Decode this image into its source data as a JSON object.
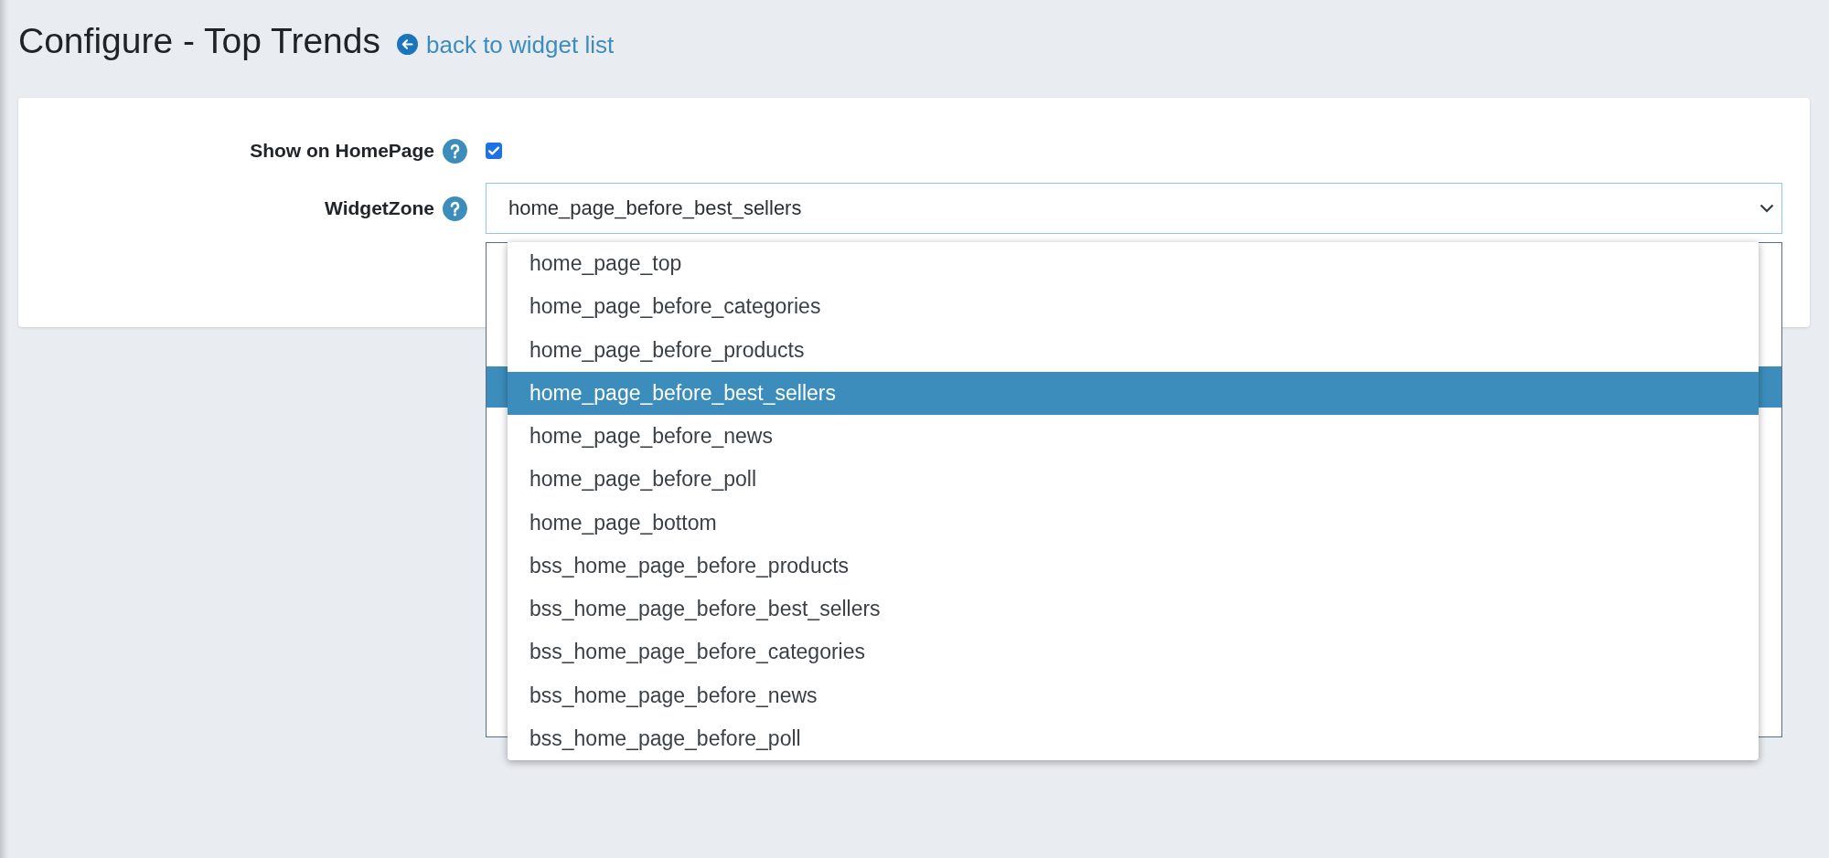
{
  "header": {
    "title": "Configure - Top Trends",
    "back_link": "back to widget list"
  },
  "form": {
    "fields": [
      {
        "kind": "checkbox",
        "label": "Show on HomePage",
        "checked": true
      },
      {
        "kind": "select",
        "label": "WidgetZone",
        "value": "home_page_before_best_sellers",
        "expanded": true,
        "options": [
          {
            "label": "home_page_top",
            "selected": false
          },
          {
            "label": "home_page_before_categories",
            "selected": false
          },
          {
            "label": "home_page_before_products",
            "selected": false
          },
          {
            "label": "home_page_before_best_sellers",
            "selected": true
          },
          {
            "label": "home_page_before_news",
            "selected": false
          },
          {
            "label": "home_page_before_poll",
            "selected": false
          },
          {
            "label": "home_page_bottom",
            "selected": false
          },
          {
            "label": "bss_home_page_before_products",
            "selected": false
          },
          {
            "label": "bss_home_page_before_best_sellers",
            "selected": false
          },
          {
            "label": "bss_home_page_before_categories",
            "selected": false
          },
          {
            "label": "bss_home_page_before_news",
            "selected": false
          },
          {
            "label": "bss_home_page_before_poll",
            "selected": false
          }
        ]
      }
    ]
  }
}
